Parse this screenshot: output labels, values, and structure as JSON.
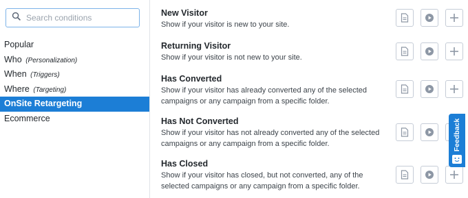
{
  "search": {
    "placeholder": "Search conditions"
  },
  "sidebar": {
    "items": [
      {
        "label": "Popular",
        "sub": ""
      },
      {
        "label": "Who",
        "sub": "(Personalization)"
      },
      {
        "label": "When",
        "sub": "(Triggers)"
      },
      {
        "label": "Where",
        "sub": "(Targeting)"
      },
      {
        "label": "OnSite Retargeting",
        "sub": "",
        "active": true
      },
      {
        "label": "Ecommerce",
        "sub": ""
      }
    ]
  },
  "conditions": [
    {
      "title": "New Visitor",
      "description": "Show if your visitor is new to your site."
    },
    {
      "title": "Returning Visitor",
      "description": "Show if your visitor is not new to your site."
    },
    {
      "title": "Has Converted",
      "description": "Show if your visitor has already converted any of the selected campaigns or any campaign from a specific folder."
    },
    {
      "title": "Has Not Converted",
      "description": "Show if your visitor has not already converted any of the selected campaigns or any campaign from a specific folder."
    },
    {
      "title": "Has Closed",
      "description": "Show if your visitor has closed, but not converted, any of the selected campaigns or any campaign from a specific folder."
    }
  ],
  "feedback": {
    "label": "Feedback",
    "icon": "chat-icon"
  },
  "icons": {
    "docs": "document-icon",
    "video": "play-icon",
    "add": "plus-icon",
    "search": "search-icon"
  },
  "colors": {
    "accent": "#1c7ed6",
    "border": "#c5ccd6"
  }
}
